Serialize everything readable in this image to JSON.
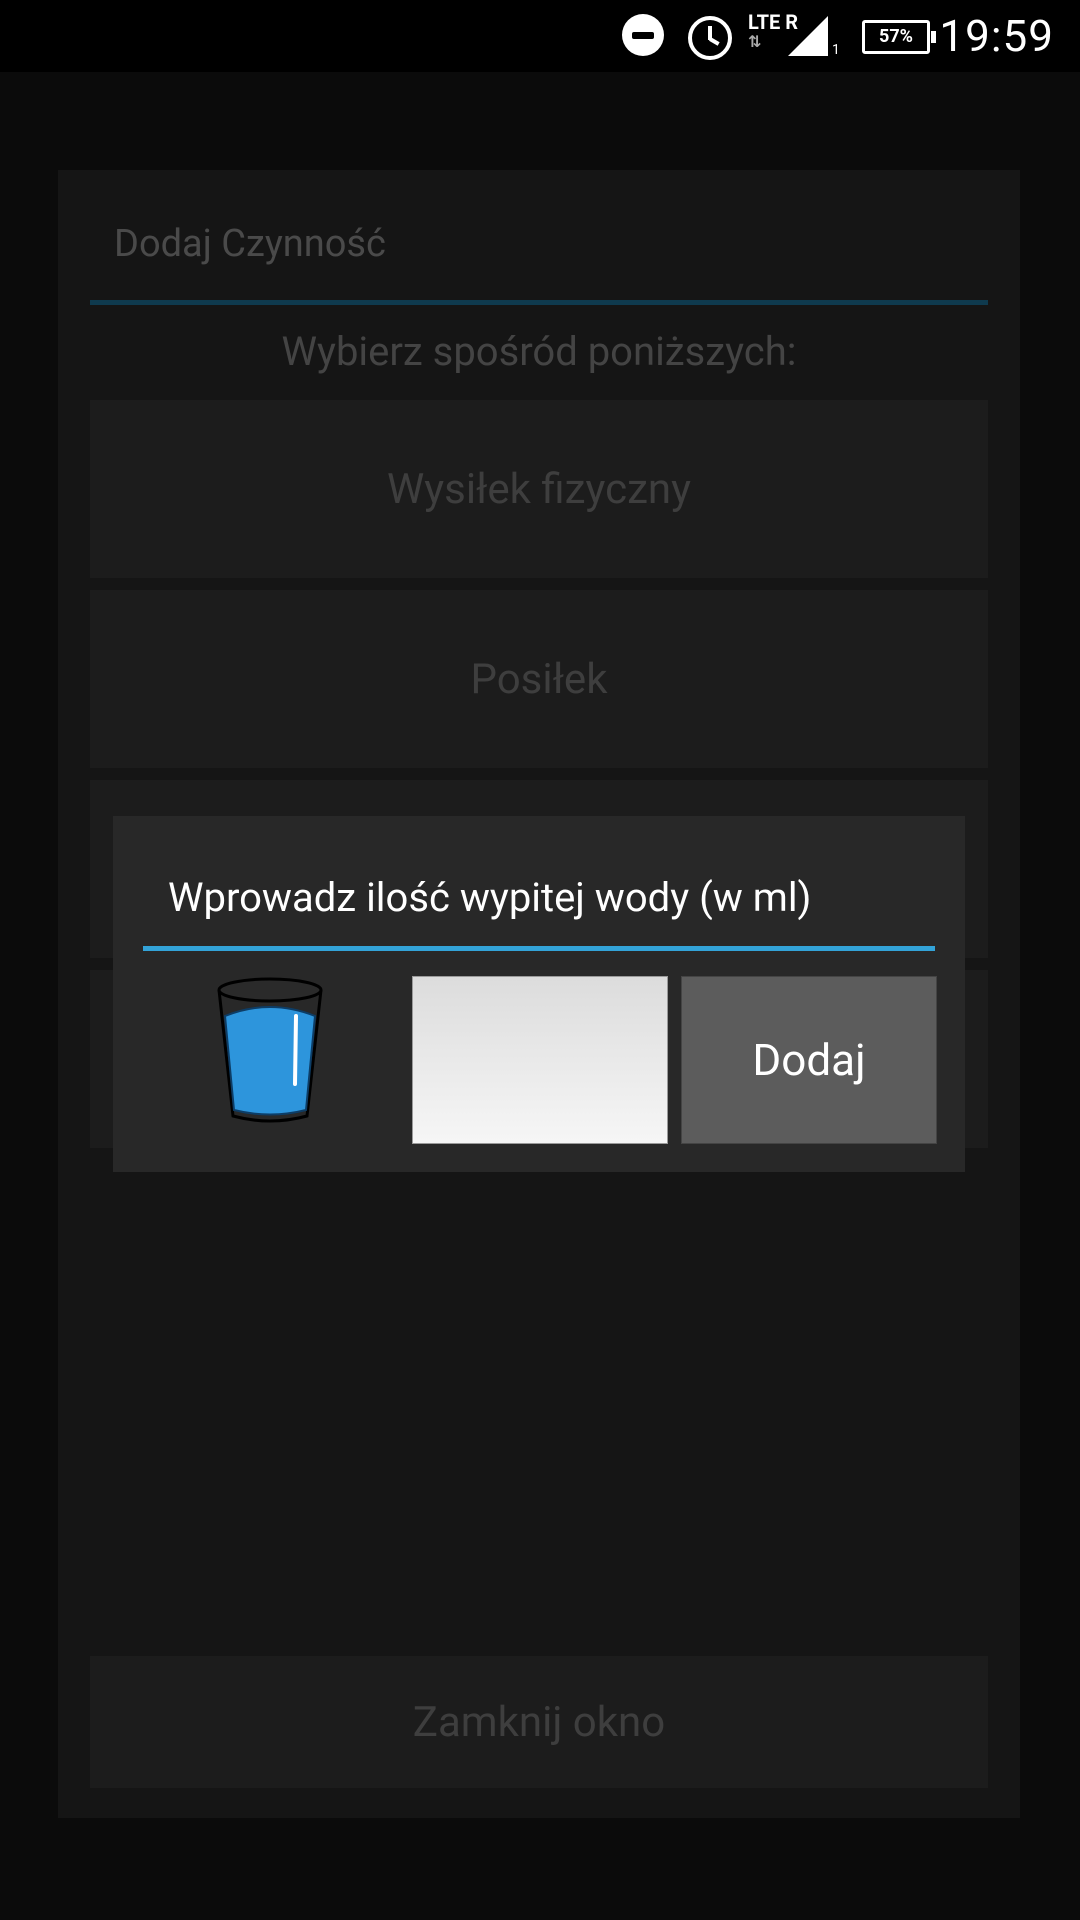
{
  "status_bar": {
    "time": "19:59",
    "battery": "57%",
    "network": "LTE",
    "roaming": "R",
    "sim_slot": "1",
    "icons": [
      "do-not-disturb-icon",
      "alarm-icon",
      "lte-icon",
      "signal-icon",
      "battery-icon"
    ]
  },
  "background_dialog": {
    "title": "Dodaj Czynność",
    "subtitle": "Wybierz spośród poniższych:",
    "options": [
      "Wysiłek fizyczny",
      "Posiłek",
      "",
      ""
    ],
    "close_label": "Zamknij okno"
  },
  "water_dialog": {
    "title": "Wprowadz ilość wypitej wody (w ml)",
    "input_value": "",
    "add_label": "Dodaj",
    "accent_color": "#33a3d8",
    "icon": "water-glass-icon"
  }
}
